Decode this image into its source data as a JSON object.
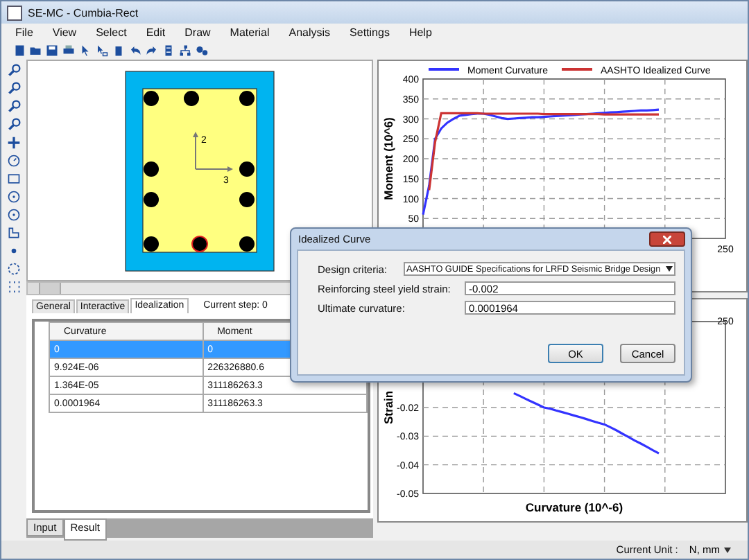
{
  "window": {
    "title": "SE-MC - Cumbia-Rect"
  },
  "menu": [
    "File",
    "View",
    "Select",
    "Edit",
    "Draw",
    "Material",
    "Analysis",
    "Settings",
    "Help"
  ],
  "section": {
    "axis_labels": [
      "2",
      "3"
    ]
  },
  "result_tabs": [
    {
      "label": "General",
      "selected": false
    },
    {
      "label": "Interactive",
      "selected": false
    },
    {
      "label": "Idealization",
      "selected": true
    }
  ],
  "current_step": "Current step: 0",
  "table": {
    "columns": [
      "Curvature",
      "Moment"
    ],
    "rows": [
      {
        "cells": [
          "0",
          "0"
        ],
        "selected": true
      },
      {
        "cells": [
          "9.924E-06",
          "226326880.6"
        ],
        "selected": false
      },
      {
        "cells": [
          "1.364E-05",
          "311186263.3"
        ],
        "selected": false
      },
      {
        "cells": [
          "0.0001964",
          "311186263.3"
        ],
        "selected": false
      }
    ]
  },
  "bottom_tabs": [
    {
      "label": "Input",
      "selected": false
    },
    {
      "label": "Result",
      "selected": true
    }
  ],
  "moment_chart": {
    "chart_data": {
      "type": "line",
      "ylabel": "Moment (10^6)",
      "grid": true,
      "legend": true,
      "series": [
        {
          "name": "Moment Curvature",
          "color": "#3333ff",
          "values": [
            60,
            133,
            250,
            276,
            290,
            300,
            308,
            310,
            312,
            313,
            313,
            310,
            306,
            302,
            300,
            301,
            302,
            303,
            304,
            304,
            305,
            306,
            307,
            308,
            309,
            310,
            311,
            312,
            313,
            314,
            315,
            316,
            317,
            318,
            319,
            320,
            321,
            321,
            322,
            323
          ]
        },
        {
          "name": "AASHTO Idealized Curve",
          "color": "#cc3333",
          "values": [
            null,
            121,
            242,
            314,
            314,
            314,
            314,
            314,
            314,
            314,
            313,
            313,
            313,
            313,
            313,
            313,
            313,
            313,
            313,
            313,
            312,
            312,
            312,
            312,
            312,
            312,
            312,
            312,
            312,
            312,
            311,
            311,
            311,
            311,
            311,
            311,
            311,
            311,
            311,
            311
          ]
        }
      ],
      "ylim": [
        0,
        400
      ],
      "yticks": [
        50,
        100,
        150,
        200,
        250,
        300,
        350,
        400
      ],
      "annotations": [
        "250"
      ]
    }
  },
  "strain_chart": {
    "chart_data": {
      "type": "line",
      "xlabel": "Curvature (10^-6)",
      "ylabel": "Strain",
      "grid": true,
      "series": [
        {
          "color": "#3333ff",
          "values": [
            null,
            null,
            null,
            null,
            null,
            null,
            null,
            null,
            null,
            null,
            null,
            null,
            null,
            null,
            null,
            -0.015,
            -0.016,
            -0.017,
            -0.018,
            -0.019,
            -0.02,
            -0.0204,
            -0.021,
            -0.0216,
            -0.0222,
            -0.0228,
            -0.0234,
            -0.024,
            -0.0247,
            -0.0253,
            -0.0259,
            -0.0269,
            -0.028,
            -0.0292,
            -0.0303,
            -0.0315,
            -0.0326,
            -0.0337,
            -0.0349,
            -0.036
          ]
        }
      ],
      "ylim": [
        -0.05,
        0.01
      ],
      "yticks": [
        -0.02,
        -0.03,
        -0.04,
        -0.05
      ],
      "annotations": [
        "250"
      ]
    }
  },
  "dialog": {
    "title": "Idealized Curve",
    "fields": [
      {
        "kind": "select",
        "label": "Design criteria:",
        "value": "AASHTO GUIDE Specifications for LRFD Seismic Bridge Design"
      },
      {
        "kind": "text",
        "label": "Reinforcing steel yield strain:",
        "value": "-0.002"
      },
      {
        "kind": "text",
        "label": "Ultimate curvature:",
        "value": "0.0001964"
      }
    ],
    "buttons": [
      "OK",
      "Cancel"
    ]
  },
  "status_bar": {
    "label": "Current Unit :",
    "unit": "N, mm"
  }
}
